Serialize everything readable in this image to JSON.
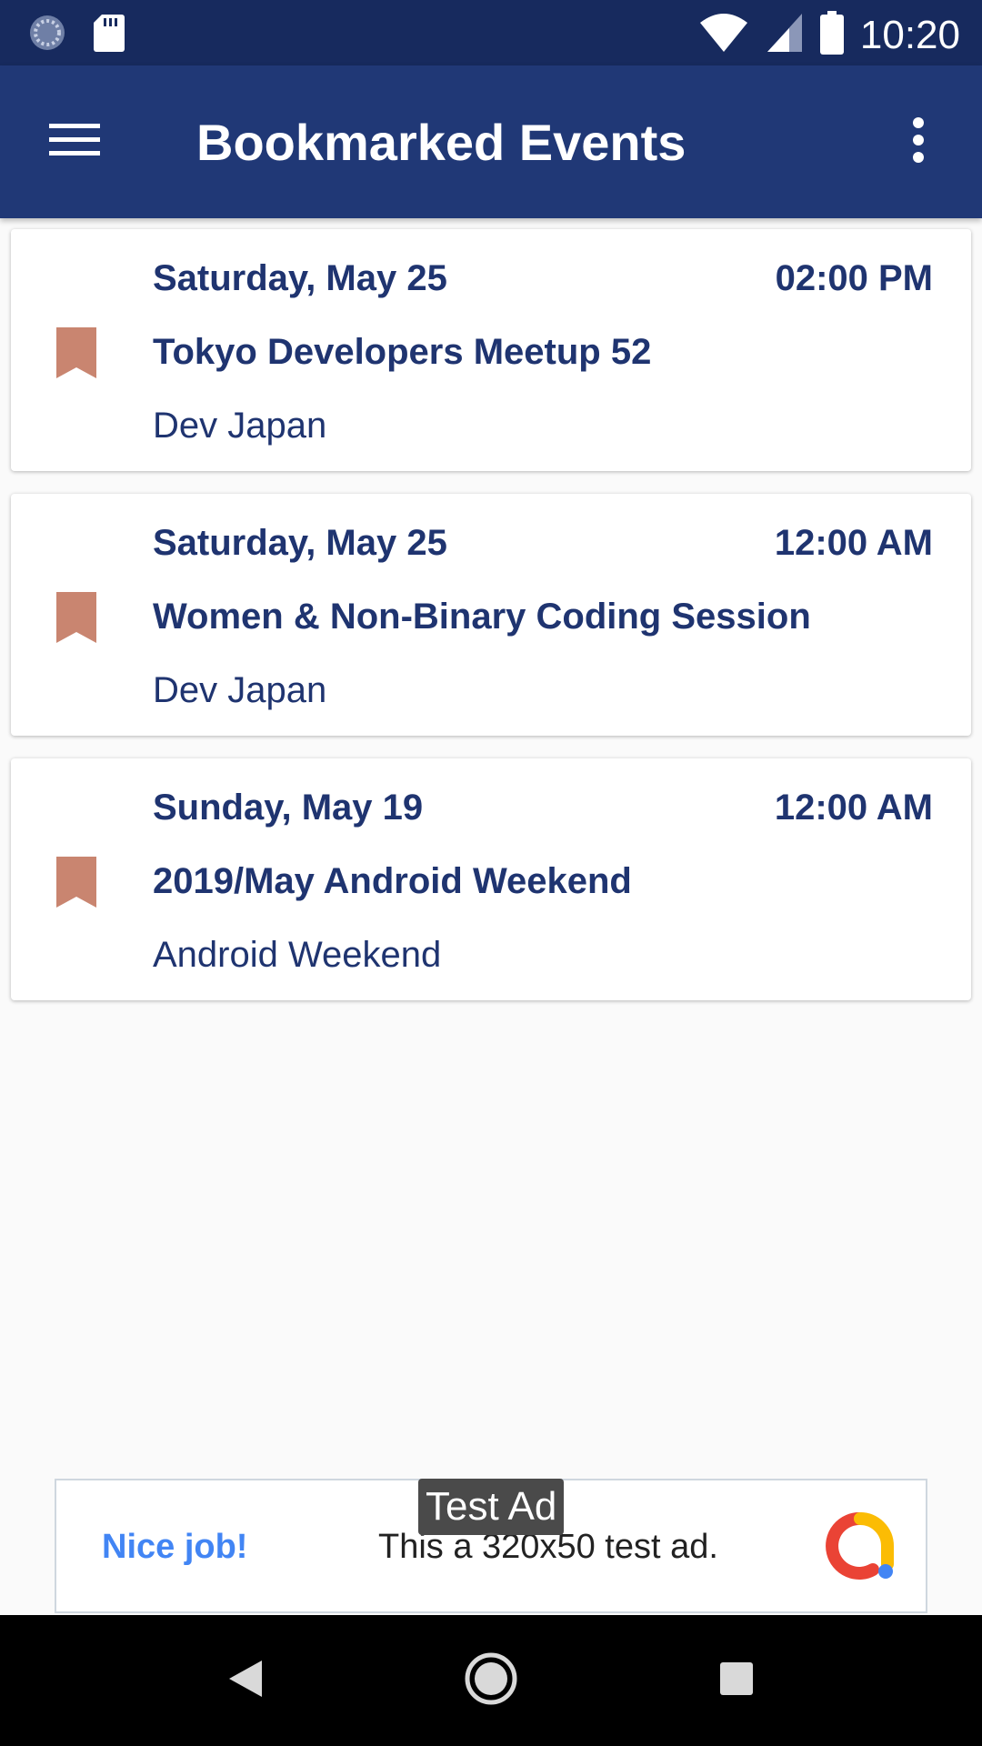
{
  "status_bar": {
    "time": "10:20",
    "icons": [
      "sync-icon",
      "sd-card-icon",
      "wifi-icon",
      "signal-icon",
      "battery-icon"
    ]
  },
  "app_bar": {
    "title": "Bookmarked Events",
    "menu_icon": "hamburger-menu-icon",
    "overflow_icon": "more-vert-icon"
  },
  "events": [
    {
      "date": "Saturday, May 25",
      "time": "02:00 PM",
      "title": "Tokyo Developers Meetup 52",
      "group": "Dev Japan",
      "bookmarked": true
    },
    {
      "date": "Saturday, May 25",
      "time": "12:00 AM",
      "title": "Women & Non-Binary Coding Session",
      "group": "Dev Japan",
      "bookmarked": true
    },
    {
      "date": "Sunday, May 19",
      "time": "12:00 AM",
      "title": "2019/May Android Weekend",
      "group": "Android Weekend",
      "bookmarked": true
    }
  ],
  "ad": {
    "tag": "Test Ad",
    "headline": "Nice job!",
    "body": "This a 320x50 test ad."
  },
  "nav_bar": {
    "icons": [
      "back-icon",
      "home-icon",
      "recents-icon"
    ]
  },
  "colors": {
    "status_bar": "#172a5e",
    "app_bar": "#203876",
    "text_primary": "#1f3470",
    "bookmark": "#c98570",
    "ad_headline": "#4285f4"
  }
}
